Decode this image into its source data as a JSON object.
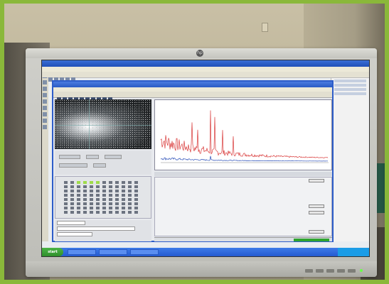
{
  "photo": {
    "border_color": "#8ab83a",
    "monitor_brand_icon": "hp-logo-icon"
  },
  "screen": {
    "accent": "#2d5dc9",
    "spectrum_series": [
      {
        "name": "",
        "color": "#d93a3a"
      },
      {
        "name": "",
        "color": "#2b4fb8"
      }
    ]
  },
  "taskbar": {
    "start_label": "start"
  }
}
